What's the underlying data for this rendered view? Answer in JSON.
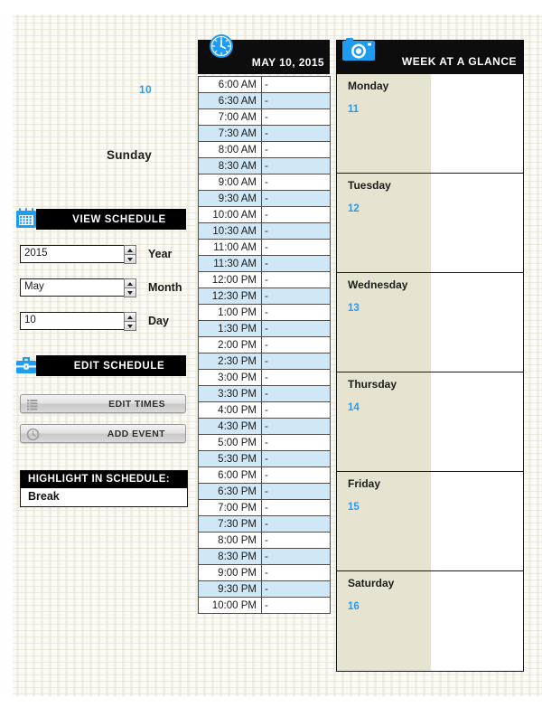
{
  "today": {
    "day_number": "10",
    "day_name": "Sunday",
    "number_color": "#2e9bea"
  },
  "view_schedule": {
    "icon": "calendar-icon",
    "title": "VIEW SCHEDULE",
    "fields": [
      {
        "name": "year",
        "value": "2015",
        "label": "Year"
      },
      {
        "name": "month",
        "value": "May",
        "label": "Month"
      },
      {
        "name": "day",
        "value": "10",
        "label": "Day"
      }
    ]
  },
  "edit_schedule": {
    "icon": "toolbox-icon",
    "title": "EDIT SCHEDULE",
    "buttons": [
      {
        "name": "edit-times",
        "icon": "list-icon",
        "label": "EDIT TIMES"
      },
      {
        "name": "add-event",
        "icon": "clock-icon",
        "label": "ADD EVENT"
      }
    ]
  },
  "highlight": {
    "title": "HIGHLIGHT IN SCHEDULE:",
    "value": "Break"
  },
  "day_schedule": {
    "icon": "clock-icon",
    "date": "MAY 10, 2015",
    "empty_marker": "-",
    "slots": [
      "6:00 AM",
      "6:30 AM",
      "7:00 AM",
      "7:30 AM",
      "8:00 AM",
      "8:30 AM",
      "9:00 AM",
      "9:30 AM",
      "10:00 AM",
      "10:30 AM",
      "11:00 AM",
      "11:30 AM",
      "12:00 PM",
      "12:30 PM",
      "1:00 PM",
      "1:30 PM",
      "2:00 PM",
      "2:30 PM",
      "3:00 PM",
      "3:30 PM",
      "4:00 PM",
      "4:30 PM",
      "5:00 PM",
      "5:30 PM",
      "6:00 PM",
      "6:30 PM",
      "7:00 PM",
      "7:30 PM",
      "8:00 PM",
      "8:30 PM",
      "9:00 PM",
      "9:30 PM",
      "10:00 PM"
    ]
  },
  "week_at_a_glance": {
    "icon": "camera-icon",
    "title": "WEEK AT A GLANCE",
    "days": [
      {
        "name": "Monday",
        "number": "11",
        "notes": ""
      },
      {
        "name": "Tuesday",
        "number": "12",
        "notes": ""
      },
      {
        "name": "Wednesday",
        "number": "13",
        "notes": ""
      },
      {
        "name": "Thursday",
        "number": "14",
        "notes": ""
      },
      {
        "name": "Friday",
        "number": "15",
        "notes": ""
      },
      {
        "name": "Saturday",
        "number": "16",
        "notes": ""
      }
    ]
  }
}
